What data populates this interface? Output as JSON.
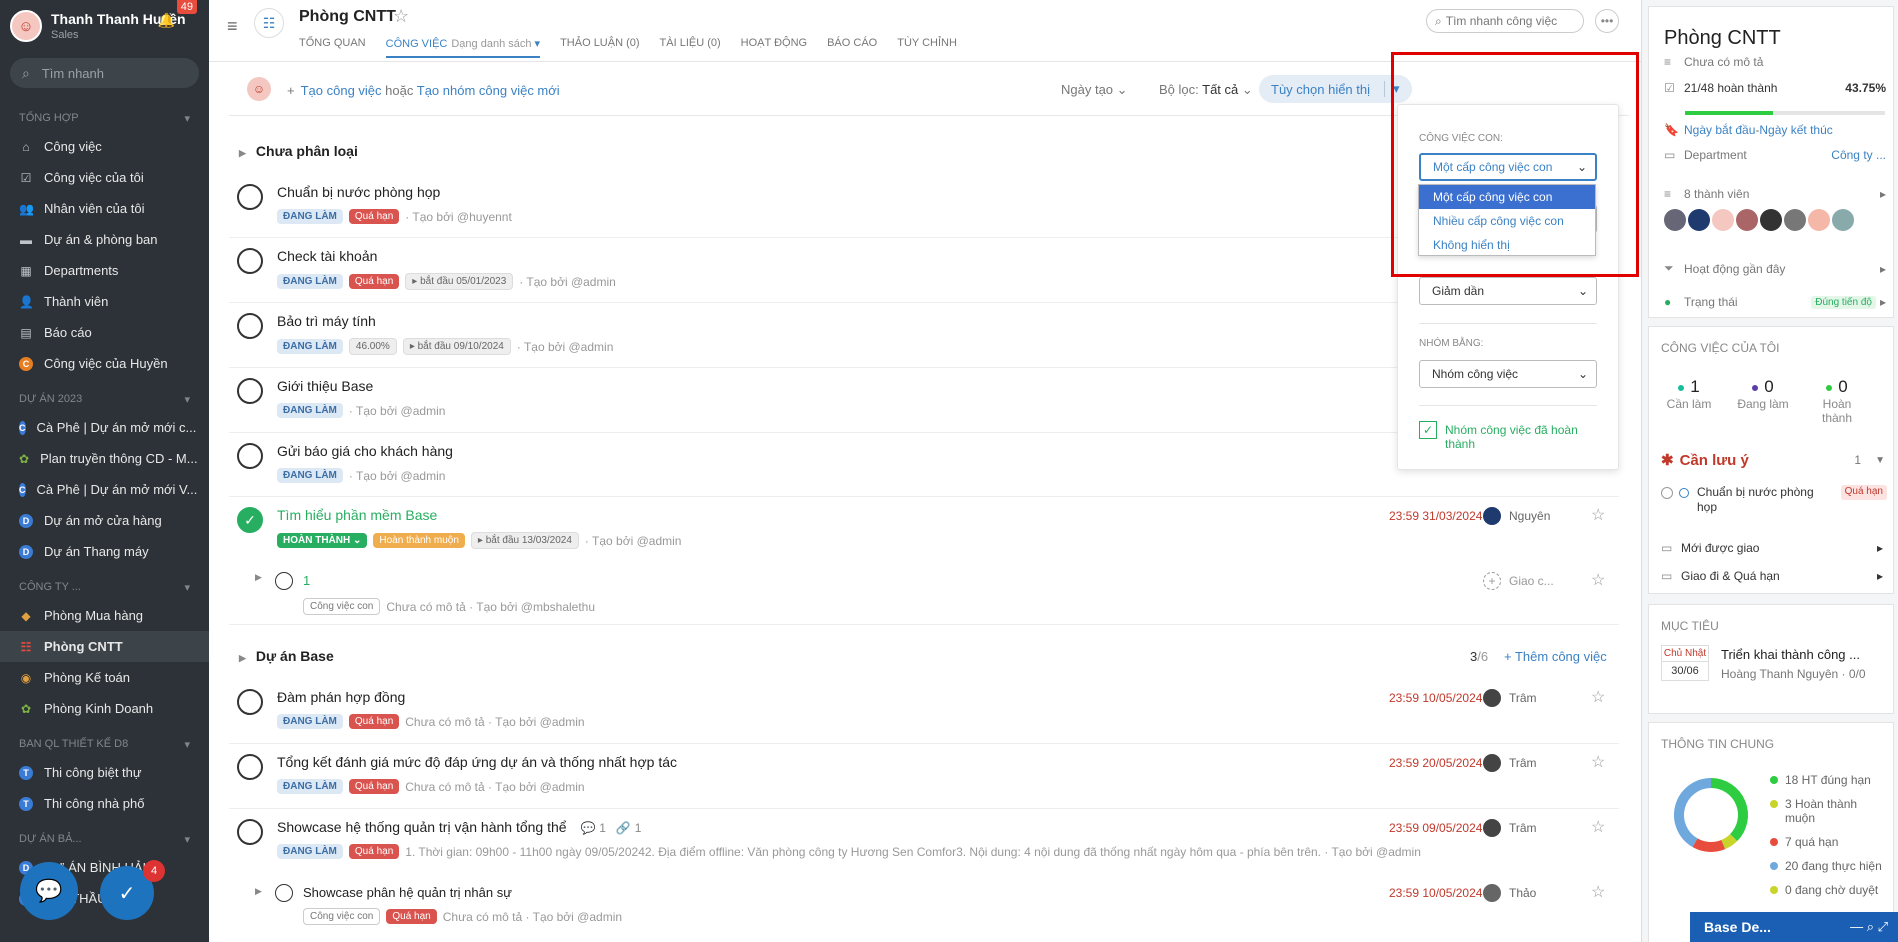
{
  "sidebar": {
    "user_name": "Thanh Thanh Huyền",
    "user_role": "Sales",
    "notif_count": "49",
    "search_placeholder": "Tìm nhanh",
    "section_general": "TỔNG HỢP",
    "general_items": [
      {
        "label": "Công việc",
        "icon": "home-icon"
      },
      {
        "label": "Công việc của tôi",
        "icon": "checkbox-icon"
      },
      {
        "label": "Nhân viên của tôi",
        "icon": "users-icon"
      },
      {
        "label": "Dự án & phòng ban",
        "icon": "folder-icon"
      },
      {
        "label": "Departments",
        "icon": "building-icon"
      },
      {
        "label": "Thành viên",
        "icon": "user-plus-icon"
      },
      {
        "label": "Báo cáo",
        "icon": "chart-icon"
      },
      {
        "label": "Công việc của Huyền",
        "icon": "avatar-icon"
      }
    ],
    "section_projects": "DỰ ÁN 2023",
    "project_items": [
      {
        "label": "Cà Phê | Dự án mở mới c...",
        "letter": "C"
      },
      {
        "label": "Plan truyền thông CD - M...",
        "letter": "P"
      },
      {
        "label": "Cà Phê | Dự án mở mới V...",
        "letter": "C"
      },
      {
        "label": "Dự án mở cửa hàng",
        "letter": "D"
      },
      {
        "label": "Dự án Thang máy",
        "letter": "D"
      }
    ],
    "section_company": "CÔNG TY ...",
    "company_items": [
      {
        "label": "Phòng Mua hàng"
      },
      {
        "label": "Phòng CNTT"
      },
      {
        "label": "Phòng Kế toán"
      },
      {
        "label": "Phòng Kinh Doanh"
      }
    ],
    "section_design": "BAN QL THIẾT KẾ D8",
    "design_items": [
      {
        "label": "Thi công biệt thự",
        "letter": "T"
      },
      {
        "label": "Thi công nhà phố",
        "letter": "T"
      }
    ],
    "section_partial": "DỰ ÁN BẢ...",
    "partial_item_1": "DỰ ÁN BÌNH HẢI...",
    "partial_item_2": "GÓI THẦU SỐ 28",
    "task_badge": "4"
  },
  "header": {
    "title": "Phòng CNTT",
    "tabs": [
      {
        "label": "TỔNG QUAN"
      },
      {
        "label": "CÔNG VIỆC",
        "sub": "Dạng danh sách"
      },
      {
        "label": "THẢO LUẬN (0)"
      },
      {
        "label": "TÀI LIỆU (0)"
      },
      {
        "label": "HOẠT ĐỘNG"
      },
      {
        "label": "BÁO CÁO"
      },
      {
        "label": "TÙY CHỈNH"
      }
    ],
    "search_placeholder": "Tìm nhanh công việc"
  },
  "actionbar": {
    "create_task": "Tạo công việc",
    "or": "hoặc",
    "create_group": "Tạo nhóm công việc mới",
    "sort": "Ngày tạo",
    "filter_label": "Bộ lọc:",
    "filter_value": "Tất cả",
    "display_options": "Tùy chọn hiển thị"
  },
  "groups": [
    {
      "name": "Chưa phân loại"
    },
    {
      "name": "Dự án Base",
      "count_done": "3",
      "count_total": "/6",
      "add_label": "Thêm công việc"
    }
  ],
  "tasks": [
    {
      "title": "Chuẩn bị nước phòng họp",
      "status": "ĐANG LÀM",
      "tag": "Quá hạn",
      "extra": "",
      "desc": "",
      "creator": "· Tạo bởi @huyennt",
      "due": "",
      "user": ""
    },
    {
      "title": "Check tài khoản",
      "status": "ĐANG LÀM",
      "tag": "Quá hạn",
      "extra": "bắt đầu 05/01/2023",
      "desc": "",
      "creator": "· Tạo bởi @admin",
      "due": "",
      "user": ""
    },
    {
      "title": "Bảo trì máy tính",
      "status": "ĐANG LÀM",
      "tag": "46.00%",
      "extra": "bắt đầu 09/10/2024",
      "desc": "",
      "creator": "· Tạo bởi @admin",
      "due": "",
      "user": ""
    },
    {
      "title": "Giới thiệu Base",
      "status": "ĐANG LÀM",
      "tag": "",
      "extra": "",
      "desc": "",
      "creator": "· Tạo bởi @admin",
      "due": "",
      "user": ""
    },
    {
      "title": "Gửi báo giá cho khách hàng",
      "status": "ĐANG LÀM",
      "tag": "",
      "extra": "",
      "desc": "",
      "creator": "· Tạo bởi @admin",
      "due": "",
      "user": ""
    },
    {
      "title": "Tìm hiểu phần mềm Base",
      "status": "HOÀN THÀNH",
      "tag": "Hoàn thành muộn",
      "extra": "bắt đầu 13/03/2024",
      "desc": "",
      "creator": "· Tạo bởi @admin",
      "due": "23:59 31/03/2024",
      "user": "Nguyên"
    },
    {
      "title": "1",
      "status": "Công việc con",
      "tag": "",
      "extra": "",
      "desc": "Chưa có mô tả",
      "creator": "· Tạo bởi @mbshalethu",
      "due": "",
      "user": "Giao c..."
    },
    {
      "title": "Đàm phán hợp đồng",
      "status": "ĐANG LÀM",
      "tag": "Quá hạn",
      "extra": "",
      "desc": "Chưa có mô tả",
      "creator": "· Tạo bởi @admin",
      "due": "23:59 10/05/2024",
      "user": "Trâm"
    },
    {
      "title": "Tổng kết đánh giá mức độ đáp ứng dự án và thống nhất hợp tác",
      "status": "ĐANG LÀM",
      "tag": "Quá hạn",
      "extra": "",
      "desc": "Chưa có mô tả",
      "creator": "· Tạo bởi @admin",
      "due": "23:59 20/05/2024",
      "user": "Trâm"
    },
    {
      "title": "Showcase hệ thống quản trị vận hành tổng thể",
      "status": "ĐANG LÀM",
      "tag": "Quá hạn",
      "extra": "",
      "desc": "1. Thời gian: 09h00 - 11h00 ngày 09/05/20242. Địa điểm offline: Văn phòng công ty Hương Sen Comfor3. Nội dung: 4 nội dung đã thống nhất ngày hôm qua - phía bên trên.",
      "creator": "· Tạo bởi @admin",
      "due": "23:59 09/05/2024",
      "user": "Trâm",
      "comments": "1",
      "attachments": "1"
    },
    {
      "title": "Showcase phân hệ quản trị nhân sự",
      "status": "Công việc con",
      "tag": "Quá hạn",
      "extra": "",
      "desc": "Chưa có mô tả",
      "creator": "· Tạo bởi @admin",
      "due": "23:59 10/05/2024",
      "user": "Thảo"
    }
  ],
  "popup": {
    "subtask_label": "CÔNG VIỆC CON:",
    "subtask_value": "Một cấp công việc con",
    "subtask_options": [
      "Một cấp công việc con",
      "Nhiều cấp công việc con",
      "Không hiển thị"
    ],
    "order_value": "Giảm dần",
    "group_label": "NHÓM BẰNG:",
    "group_value": "Nhóm công việc",
    "show_done_label": "Nhóm công việc đã hoàn thành"
  },
  "right": {
    "title": "Phòng CNTT",
    "desc": "Chưa có mô tả",
    "progress_label": "21/48 hoàn thành",
    "progress_pct": "43.75%",
    "progress_value": 0.4375,
    "start": "Ngày bắt đầu",
    "dash": " - ",
    "end": "Ngày kết thúc",
    "department_label": "Department",
    "department_value": "Công ty ...",
    "members": "8 thành viên",
    "recent": "Hoạt động gần đây",
    "status_label": "Trạng thái",
    "status_value": "Đúng tiến độ",
    "mytasks_label": "CÔNG VIỆC CỦA TÔI",
    "stats": [
      {
        "value": "1",
        "label": "Cần làm",
        "color": "#1abc9c"
      },
      {
        "value": "0",
        "label": "Đang làm",
        "color": "#5b3fa8"
      },
      {
        "value": "0",
        "label": "Hoàn thành",
        "color": "#2ecc40"
      }
    ],
    "attention_label": "Cần lưu ý",
    "attention_count": "1",
    "attention_task": "Chuẩn bị nước phòng họp",
    "attention_tag": "Quá hạn",
    "newly_assigned": "Mới được giao",
    "assigned_overdue": "Giao đi & Quá hạn",
    "goals_label": "MỤC TIÊU",
    "goal_day": "Chủ Nhật",
    "goal_date": "30/06",
    "goal_title": "Triển khai thành công ...",
    "goal_owner": "Hoàng Thanh Nguyên",
    "goal_ratio": "· 0/0",
    "general_label": "THÔNG TIN CHUNG",
    "legend": [
      {
        "label": "18 HT đúng hạn",
        "color": "#2ecc40",
        "value": 18
      },
      {
        "label": "3 Hoàn thành muộn",
        "color": "#c8d42a",
        "value": 3
      },
      {
        "label": "7 quá hạn",
        "color": "#e74c3c",
        "value": 7
      },
      {
        "label": "20 đang thực hiện",
        "color": "#6fa8dc",
        "value": 20
      },
      {
        "label": "0 đang chờ duyệt",
        "color": "#c8d42a",
        "value": 0
      }
    ],
    "base_de": "Base De..."
  }
}
